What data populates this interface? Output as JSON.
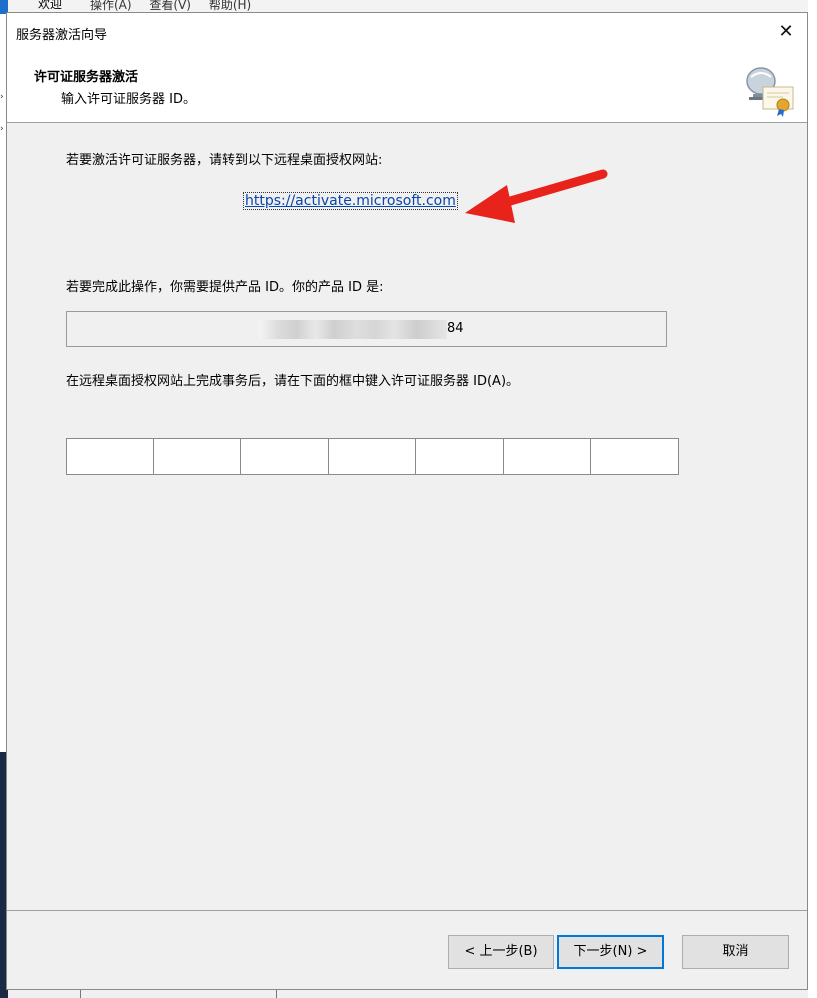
{
  "background": {
    "menu_tab": "欢迎",
    "menus": [
      "操作(A)",
      "查看(V)",
      "帮助(H)"
    ]
  },
  "dialog": {
    "title": "服务器激活向导",
    "header": {
      "title": "许可证服务器激活",
      "subtitle": "输入许可证服务器 ID。"
    },
    "instruction": "若要激活许可证服务器，请转到以下远程桌面授权网站:",
    "link": "https://activate.microsoft.com",
    "product_id_label": "若要完成此操作，你需要提供产品 ID。你的产品 ID 是:",
    "product_id_visible_suffix": "84",
    "license_id_label": "在远程桌面授权网站上完成事务后，请在下面的框中键入许可证服务器 ID(A)。",
    "license_id_fields": [
      "",
      "",
      "",
      "",
      "",
      "",
      ""
    ],
    "buttons": {
      "back": "< 上一步(B)",
      "next": "下一步(N) >",
      "cancel": "取消"
    }
  },
  "annotation_color": "#e8231c",
  "icons": [
    "close-icon",
    "license-server-icon",
    "red-arrow-annotation"
  ]
}
